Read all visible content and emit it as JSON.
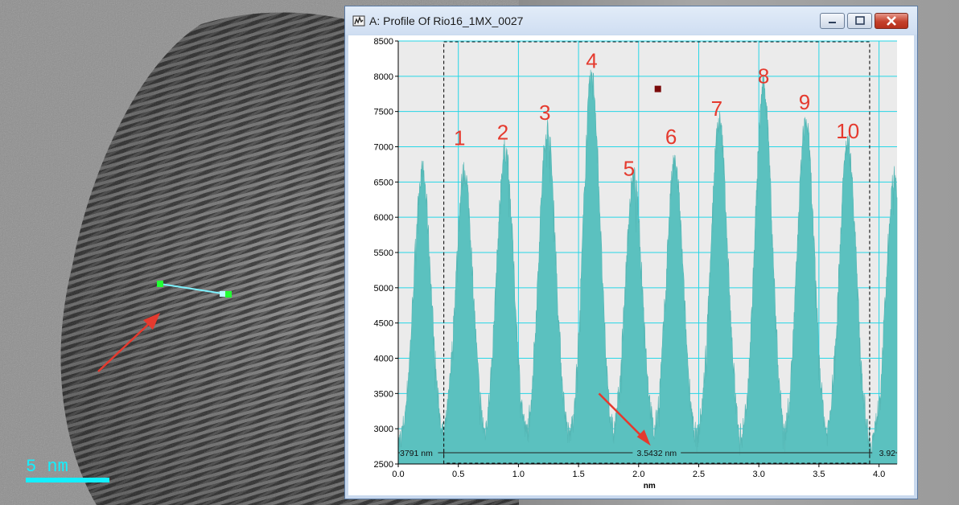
{
  "window": {
    "title": "A: Profile Of Rio16_1MX_0027"
  },
  "scale_bar": {
    "label": "5 nm"
  },
  "colors": {
    "accent": "#12f0ff",
    "plot_fill": "#5bc1bf",
    "grid": "#26d6e6",
    "annotation": "#e53a2e",
    "scale_bar": "#12f0ff"
  },
  "icons": {
    "app": "profile-window-icon",
    "minimize": "minimize-icon",
    "maximize": "maximize-icon",
    "close": "close-icon"
  },
  "chart_data": {
    "type": "area",
    "xlabel": "nm",
    "ylabel": "",
    "xlim": [
      0,
      4.15
    ],
    "ylim": [
      2500,
      8500
    ],
    "x_ticks": [
      0.0,
      0.5,
      1.0,
      1.5,
      2.0,
      2.5,
      3.0,
      3.5,
      4.0
    ],
    "x_tick_labels": [
      "0.0",
      "0.5",
      "1.0",
      "1.5",
      "2.0",
      "2.5",
      "3.0",
      "3.5",
      "4.0"
    ],
    "y_ticks": [
      2500,
      3000,
      3500,
      4000,
      4500,
      5000,
      5500,
      6000,
      6500,
      7000,
      7500,
      8000,
      8500
    ],
    "y_tick_labels": [
      "2500",
      "3000",
      "3500",
      "4000",
      "4500",
      "5000",
      "5500",
      "6000",
      "6500",
      "7000",
      "7500",
      "8000",
      "8500"
    ],
    "grid": true,
    "peaks": [
      {
        "x": 0.2,
        "y": 6650
      },
      {
        "x": 0.55,
        "y": 6650
      },
      {
        "x": 0.89,
        "y": 6950
      },
      {
        "x": 1.24,
        "y": 7250
      },
      {
        "x": 1.61,
        "y": 8000
      },
      {
        "x": 1.96,
        "y": 6550
      },
      {
        "x": 2.3,
        "y": 6750
      },
      {
        "x": 2.67,
        "y": 7350
      },
      {
        "x": 3.04,
        "y": 7850
      },
      {
        "x": 3.39,
        "y": 7350
      },
      {
        "x": 3.74,
        "y": 7050
      },
      {
        "x": 4.13,
        "y": 6550
      }
    ],
    "baseline": 2700,
    "peak_labels": [
      {
        "text": "1",
        "x": 0.51,
        "y": 7020
      },
      {
        "text": "2",
        "x": 0.87,
        "y": 7100
      },
      {
        "text": "3",
        "x": 1.22,
        "y": 7380
      },
      {
        "text": "4",
        "x": 1.61,
        "y": 8120
      },
      {
        "text": "5",
        "x": 1.92,
        "y": 6590
      },
      {
        "text": "6",
        "x": 2.27,
        "y": 7040
      },
      {
        "text": "7",
        "x": 2.65,
        "y": 7440
      },
      {
        "text": "8",
        "x": 3.04,
        "y": 7900
      },
      {
        "text": "9",
        "x": 3.38,
        "y": 7530
      },
      {
        "text": "10",
        "x": 3.74,
        "y": 7120
      }
    ],
    "selection": {
      "x_start": 0.379,
      "x_end": 3.922
    },
    "measurement": {
      "left_label": "3791 nm",
      "center_label": "3.5432 nm",
      "right_label": "3.92"
    },
    "marker": {
      "x": 2.16,
      "y": 7820
    }
  }
}
